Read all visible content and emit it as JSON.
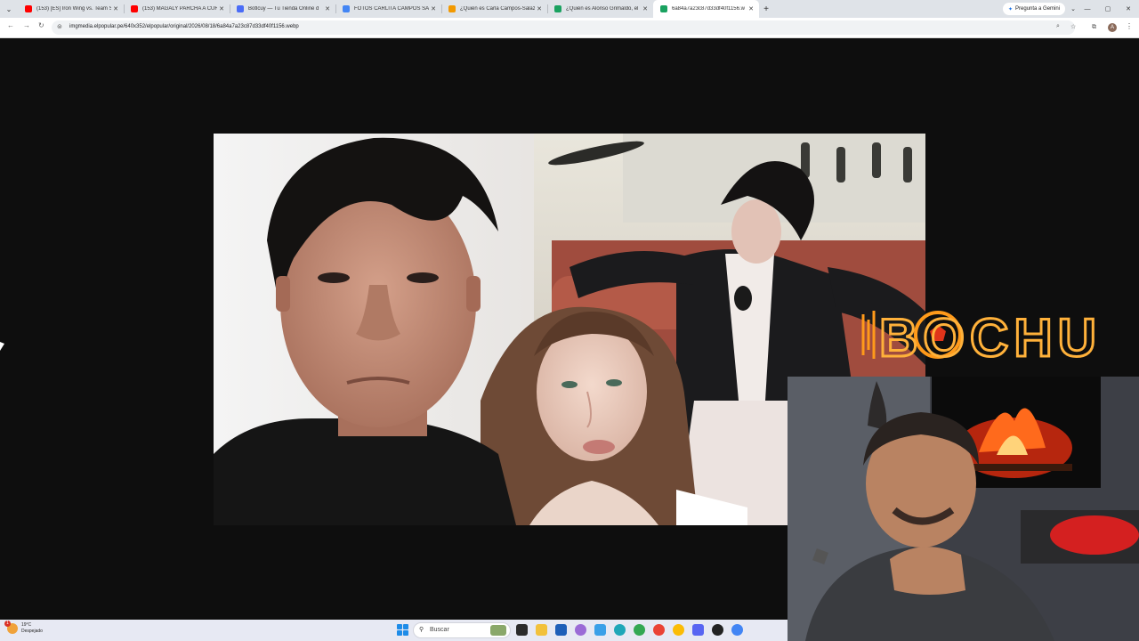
{
  "browser": {
    "tabs": [
      {
        "title": "(153) [ES] Iron Wing vs. Team Sp",
        "favicon_color": "#ff0000",
        "active": false
      },
      {
        "title": "(153) MAGALY PARCHA A CUR",
        "favicon_color": "#ff0000",
        "active": false
      },
      {
        "title": "Botlcuy — Tu Tienda Online d",
        "favicon_color": "#4a6cf7",
        "active": false
      },
      {
        "title": "FOTOS CARLITA CAMPOS SALA",
        "favicon_color": "#4285f4",
        "active": false
      },
      {
        "title": "¿Quién es Carla Campos-Salazar",
        "favicon_color": "#f29900",
        "active": false
      },
      {
        "title": "¿Quién es Alonso Grimaldo, el",
        "favicon_color": "#1aa260",
        "active": false
      },
      {
        "title": "6a84a7a23c87d33df40f1156.w",
        "favicon_color": "#1aa260",
        "active": true
      }
    ],
    "close_glyph": "✕",
    "new_tab_glyph": "+",
    "gemini_label": "Pregunta a Gemini",
    "window_controls": [
      "⌄",
      "—",
      "▢",
      "✕"
    ],
    "url": "imgmedia.elpopular.pe/640x352/elpopular/original/2026/08/18/6a84a7a23c87d33df40f1156.webp",
    "avatar_letter": "A",
    "nav": {
      "back": "←",
      "forward": "→",
      "reload": "↻",
      "site_info": "⊜",
      "zoom": "⌕",
      "star": "☆",
      "kebab": "⋮"
    }
  },
  "overlay": {
    "logo_text": "BOCHU",
    "logo_color": "#ff9a1a"
  },
  "taskbar": {
    "weather_temp": "19°C",
    "weather_desc": "Despejado",
    "weather_badge": "1",
    "search_placeholder": "Buscar",
    "search_glyph": "⚲",
    "apps": [
      "files",
      "file-explorer",
      "store",
      "copilot",
      "photos",
      "edge",
      "chrome",
      "chrome-2",
      "chrome-3",
      "discord",
      "davinci",
      "chrome-4"
    ]
  },
  "colors": {
    "tabbar_bg": "#dfe3e8",
    "page_bg": "#0e0e0e",
    "taskbar_bg": "#e7e9f3"
  }
}
